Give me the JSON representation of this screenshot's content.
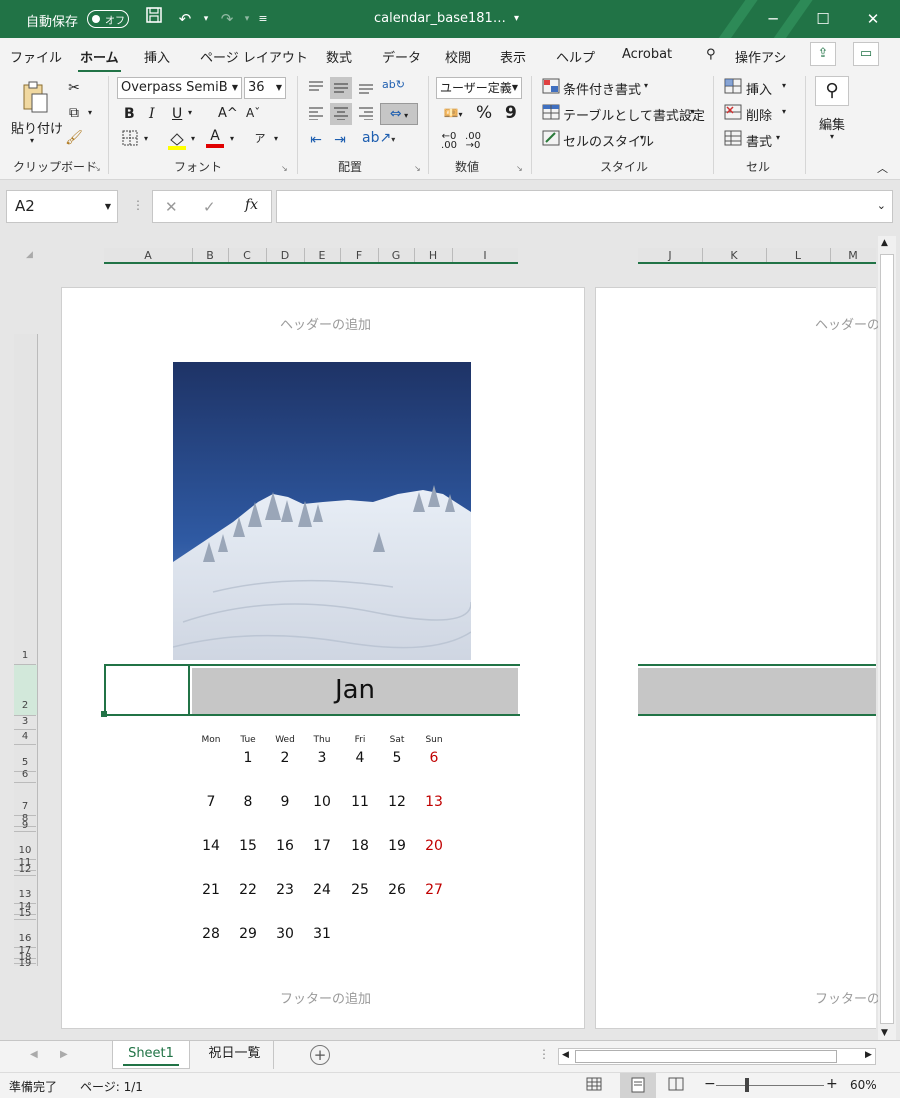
{
  "titlebar": {
    "autosave": "自動保存",
    "toggle": "オフ",
    "filename": "calendar_base181…",
    "dropdown": "▾",
    "minimize": "─",
    "maximize": "☐",
    "close": "✕"
  },
  "menu": {
    "items": [
      "ファイル",
      "ホーム",
      "挿入",
      "ページ レイアウト",
      "数式",
      "データ",
      "校閲",
      "表示",
      "ヘルプ",
      "Acrobat"
    ],
    "active": "ホーム",
    "tell": "操作アシ"
  },
  "ribbon": {
    "clipboard": {
      "paste": "貼り付け",
      "group": "クリップボード"
    },
    "font": {
      "name": "Overpass SemiB",
      "size": "36",
      "bold": "B",
      "italic": "I",
      "underline": "U",
      "grow": "A^",
      "shrink": "Aˇ",
      "color_a": "A",
      "group": "フォント"
    },
    "alignment": {
      "group": "配置"
    },
    "number": {
      "format": "ユーザー定義",
      "percent": "%",
      "comma": "9",
      "group": "数値"
    },
    "styles": {
      "conditional": "条件付き書式",
      "table": "テーブルとして書式設定",
      "cell": "セルのスタイル",
      "group": "スタイル"
    },
    "cells": {
      "insert": "挿入",
      "delete": "削除",
      "format": "書式",
      "group": "セル"
    },
    "editing": {
      "label": "編集"
    }
  },
  "formula_bar": {
    "namebox": "A2",
    "cancel": "✕",
    "enter": "✓",
    "fx": "fx",
    "value": ""
  },
  "sheet": {
    "columns_left": [
      "A",
      "B",
      "C",
      "D",
      "E",
      "F",
      "G",
      "H",
      "I"
    ],
    "columns_right": [
      "J",
      "K",
      "L",
      "M"
    ],
    "rows": [
      "1",
      "2",
      "3",
      "4",
      "5",
      "6",
      "7",
      "8",
      "9",
      "10",
      "11",
      "12",
      "13",
      "14",
      "15",
      "16",
      "17",
      "18",
      "19"
    ],
    "header_placeholder": "ヘッダーの追加",
    "header_placeholder_right": "ヘッダーの追",
    "footer_placeholder": "フッターの追加",
    "footer_placeholder_right": "フッターの追",
    "month": "Jan",
    "weekdays": [
      "Mon",
      "Tue",
      "Wed",
      "Thu",
      "Fri",
      "Sat",
      "Sun"
    ],
    "weeks": [
      [
        "",
        "1",
        "2",
        "3",
        "4",
        "5",
        "6"
      ],
      [
        "7",
        "8",
        "9",
        "10",
        "11",
        "12",
        "13"
      ],
      [
        "14",
        "15",
        "16",
        "17",
        "18",
        "19",
        "20"
      ],
      [
        "21",
        "22",
        "23",
        "24",
        "25",
        "26",
        "27"
      ],
      [
        "28",
        "29",
        "30",
        "31",
        "",
        "",
        ""
      ]
    ],
    "sunday_color": "#c00000"
  },
  "tabs": {
    "sheets": [
      "Sheet1",
      "祝日一覧"
    ],
    "active": "Sheet1",
    "add": "+"
  },
  "status": {
    "ready": "準備完了",
    "page": "ページ: 1/1",
    "zoom": "60%"
  },
  "colors": {
    "accent": "#217346"
  }
}
